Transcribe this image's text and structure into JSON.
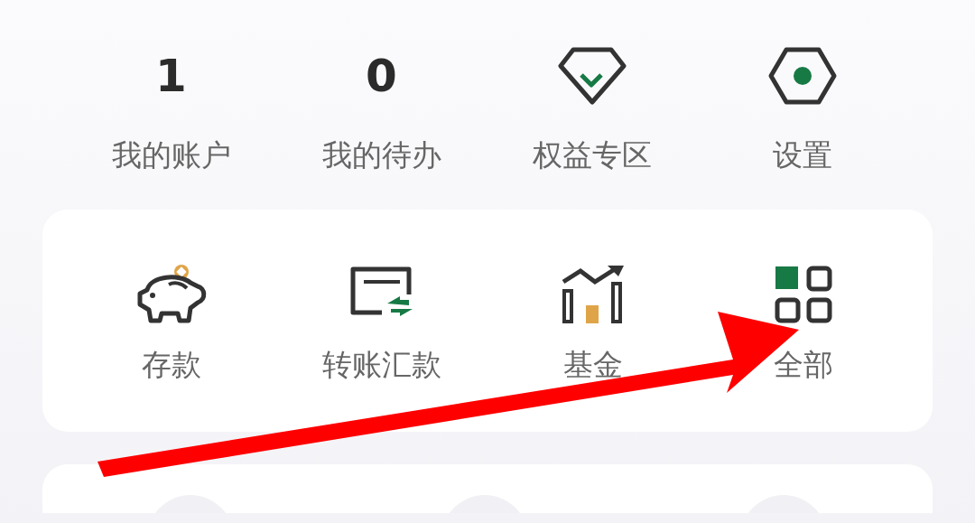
{
  "summary": [
    {
      "kind": "number",
      "value": "1",
      "label": "我的账户"
    },
    {
      "kind": "number",
      "value": "0",
      "label": "我的待办"
    },
    {
      "kind": "icon",
      "label": "权益专区"
    },
    {
      "kind": "icon",
      "label": "设置"
    }
  ],
  "services": [
    {
      "label": "存款"
    },
    {
      "label": "转账汇款"
    },
    {
      "label": "基金"
    },
    {
      "label": "全部"
    }
  ]
}
